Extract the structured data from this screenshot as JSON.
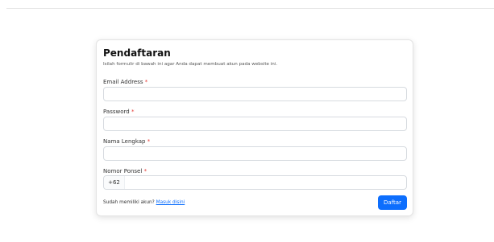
{
  "form": {
    "title": "Pendaftaran",
    "subtitle": "Isilah formulir di bawah ini agar Anda dapat membuat akun pada website ini.",
    "fields": {
      "email": {
        "label": "Email Address",
        "required_mark": "*",
        "value": ""
      },
      "password": {
        "label": "Password",
        "required_mark": "*",
        "value": ""
      },
      "fullname": {
        "label": "Nama Lengkap",
        "required_mark": "*",
        "value": ""
      },
      "phone": {
        "label": "Nomor Ponsel",
        "required_mark": "*",
        "prefix": "+62",
        "value": ""
      }
    },
    "footer": {
      "text": "Sudah memiliki akun?",
      "link_label": "Masuk disini"
    },
    "submit_label": "Daftar"
  },
  "colors": {
    "primary": "#0d6efd",
    "required": "#e53935",
    "border": "#d7dbe0"
  }
}
